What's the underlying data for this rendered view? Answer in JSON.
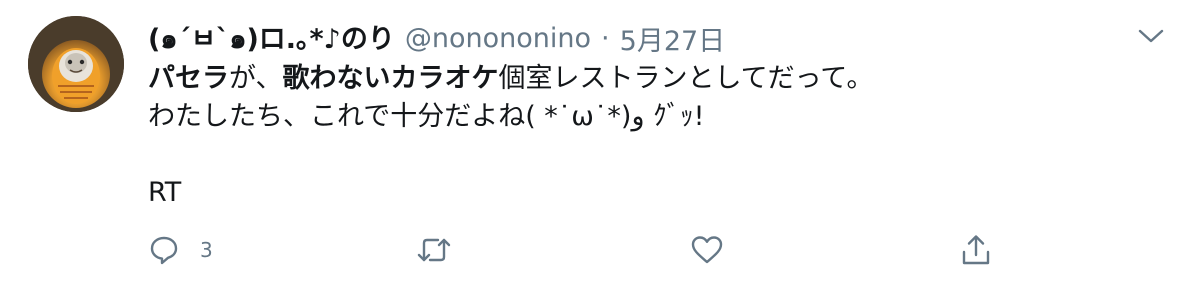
{
  "tweet": {
    "display_name": "(๑´ㅂ`๑)ロ.｡*♪のり",
    "handle": "@nonononino",
    "separator": "·",
    "date": "5月27日",
    "body": {
      "line1_b1": "パセラ",
      "line1_t1": "が、",
      "line1_b2": "歌わないカラオケ",
      "line1_t2": "個室レストランとしてだって。",
      "line2": "わたしたち、これで十分だよね( *˙ω˙*)و ｸﾞｯ!",
      "line3": "RT"
    },
    "actions": {
      "reply_count": "3",
      "retweet_count": "",
      "like_count": ""
    },
    "icons": {
      "menu": "chevron-down-icon",
      "reply": "reply-icon",
      "retweet": "retweet-icon",
      "like": "heart-icon",
      "share": "share-icon"
    },
    "colors": {
      "text": "#14171a",
      "muted": "#657786"
    }
  }
}
